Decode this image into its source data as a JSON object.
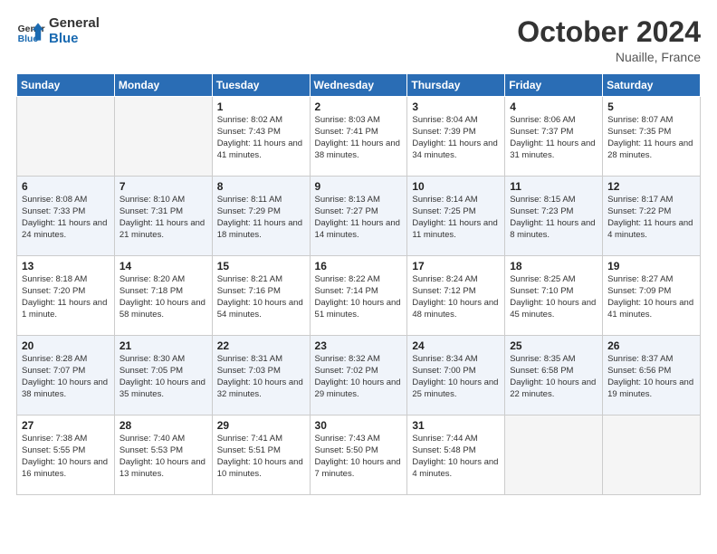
{
  "header": {
    "logo_line1": "General",
    "logo_line2": "Blue",
    "month": "October 2024",
    "location": "Nuaille, France"
  },
  "weekdays": [
    "Sunday",
    "Monday",
    "Tuesday",
    "Wednesday",
    "Thursday",
    "Friday",
    "Saturday"
  ],
  "weeks": [
    [
      {
        "day": "",
        "detail": ""
      },
      {
        "day": "",
        "detail": ""
      },
      {
        "day": "1",
        "detail": "Sunrise: 8:02 AM\nSunset: 7:43 PM\nDaylight: 11 hours and 41 minutes."
      },
      {
        "day": "2",
        "detail": "Sunrise: 8:03 AM\nSunset: 7:41 PM\nDaylight: 11 hours and 38 minutes."
      },
      {
        "day": "3",
        "detail": "Sunrise: 8:04 AM\nSunset: 7:39 PM\nDaylight: 11 hours and 34 minutes."
      },
      {
        "day": "4",
        "detail": "Sunrise: 8:06 AM\nSunset: 7:37 PM\nDaylight: 11 hours and 31 minutes."
      },
      {
        "day": "5",
        "detail": "Sunrise: 8:07 AM\nSunset: 7:35 PM\nDaylight: 11 hours and 28 minutes."
      }
    ],
    [
      {
        "day": "6",
        "detail": "Sunrise: 8:08 AM\nSunset: 7:33 PM\nDaylight: 11 hours and 24 minutes."
      },
      {
        "day": "7",
        "detail": "Sunrise: 8:10 AM\nSunset: 7:31 PM\nDaylight: 11 hours and 21 minutes."
      },
      {
        "day": "8",
        "detail": "Sunrise: 8:11 AM\nSunset: 7:29 PM\nDaylight: 11 hours and 18 minutes."
      },
      {
        "day": "9",
        "detail": "Sunrise: 8:13 AM\nSunset: 7:27 PM\nDaylight: 11 hours and 14 minutes."
      },
      {
        "day": "10",
        "detail": "Sunrise: 8:14 AM\nSunset: 7:25 PM\nDaylight: 11 hours and 11 minutes."
      },
      {
        "day": "11",
        "detail": "Sunrise: 8:15 AM\nSunset: 7:23 PM\nDaylight: 11 hours and 8 minutes."
      },
      {
        "day": "12",
        "detail": "Sunrise: 8:17 AM\nSunset: 7:22 PM\nDaylight: 11 hours and 4 minutes."
      }
    ],
    [
      {
        "day": "13",
        "detail": "Sunrise: 8:18 AM\nSunset: 7:20 PM\nDaylight: 11 hours and 1 minute."
      },
      {
        "day": "14",
        "detail": "Sunrise: 8:20 AM\nSunset: 7:18 PM\nDaylight: 10 hours and 58 minutes."
      },
      {
        "day": "15",
        "detail": "Sunrise: 8:21 AM\nSunset: 7:16 PM\nDaylight: 10 hours and 54 minutes."
      },
      {
        "day": "16",
        "detail": "Sunrise: 8:22 AM\nSunset: 7:14 PM\nDaylight: 10 hours and 51 minutes."
      },
      {
        "day": "17",
        "detail": "Sunrise: 8:24 AM\nSunset: 7:12 PM\nDaylight: 10 hours and 48 minutes."
      },
      {
        "day": "18",
        "detail": "Sunrise: 8:25 AM\nSunset: 7:10 PM\nDaylight: 10 hours and 45 minutes."
      },
      {
        "day": "19",
        "detail": "Sunrise: 8:27 AM\nSunset: 7:09 PM\nDaylight: 10 hours and 41 minutes."
      }
    ],
    [
      {
        "day": "20",
        "detail": "Sunrise: 8:28 AM\nSunset: 7:07 PM\nDaylight: 10 hours and 38 minutes."
      },
      {
        "day": "21",
        "detail": "Sunrise: 8:30 AM\nSunset: 7:05 PM\nDaylight: 10 hours and 35 minutes."
      },
      {
        "day": "22",
        "detail": "Sunrise: 8:31 AM\nSunset: 7:03 PM\nDaylight: 10 hours and 32 minutes."
      },
      {
        "day": "23",
        "detail": "Sunrise: 8:32 AM\nSunset: 7:02 PM\nDaylight: 10 hours and 29 minutes."
      },
      {
        "day": "24",
        "detail": "Sunrise: 8:34 AM\nSunset: 7:00 PM\nDaylight: 10 hours and 25 minutes."
      },
      {
        "day": "25",
        "detail": "Sunrise: 8:35 AM\nSunset: 6:58 PM\nDaylight: 10 hours and 22 minutes."
      },
      {
        "day": "26",
        "detail": "Sunrise: 8:37 AM\nSunset: 6:56 PM\nDaylight: 10 hours and 19 minutes."
      }
    ],
    [
      {
        "day": "27",
        "detail": "Sunrise: 7:38 AM\nSunset: 5:55 PM\nDaylight: 10 hours and 16 minutes."
      },
      {
        "day": "28",
        "detail": "Sunrise: 7:40 AM\nSunset: 5:53 PM\nDaylight: 10 hours and 13 minutes."
      },
      {
        "day": "29",
        "detail": "Sunrise: 7:41 AM\nSunset: 5:51 PM\nDaylight: 10 hours and 10 minutes."
      },
      {
        "day": "30",
        "detail": "Sunrise: 7:43 AM\nSunset: 5:50 PM\nDaylight: 10 hours and 7 minutes."
      },
      {
        "day": "31",
        "detail": "Sunrise: 7:44 AM\nSunset: 5:48 PM\nDaylight: 10 hours and 4 minutes."
      },
      {
        "day": "",
        "detail": ""
      },
      {
        "day": "",
        "detail": ""
      }
    ]
  ]
}
